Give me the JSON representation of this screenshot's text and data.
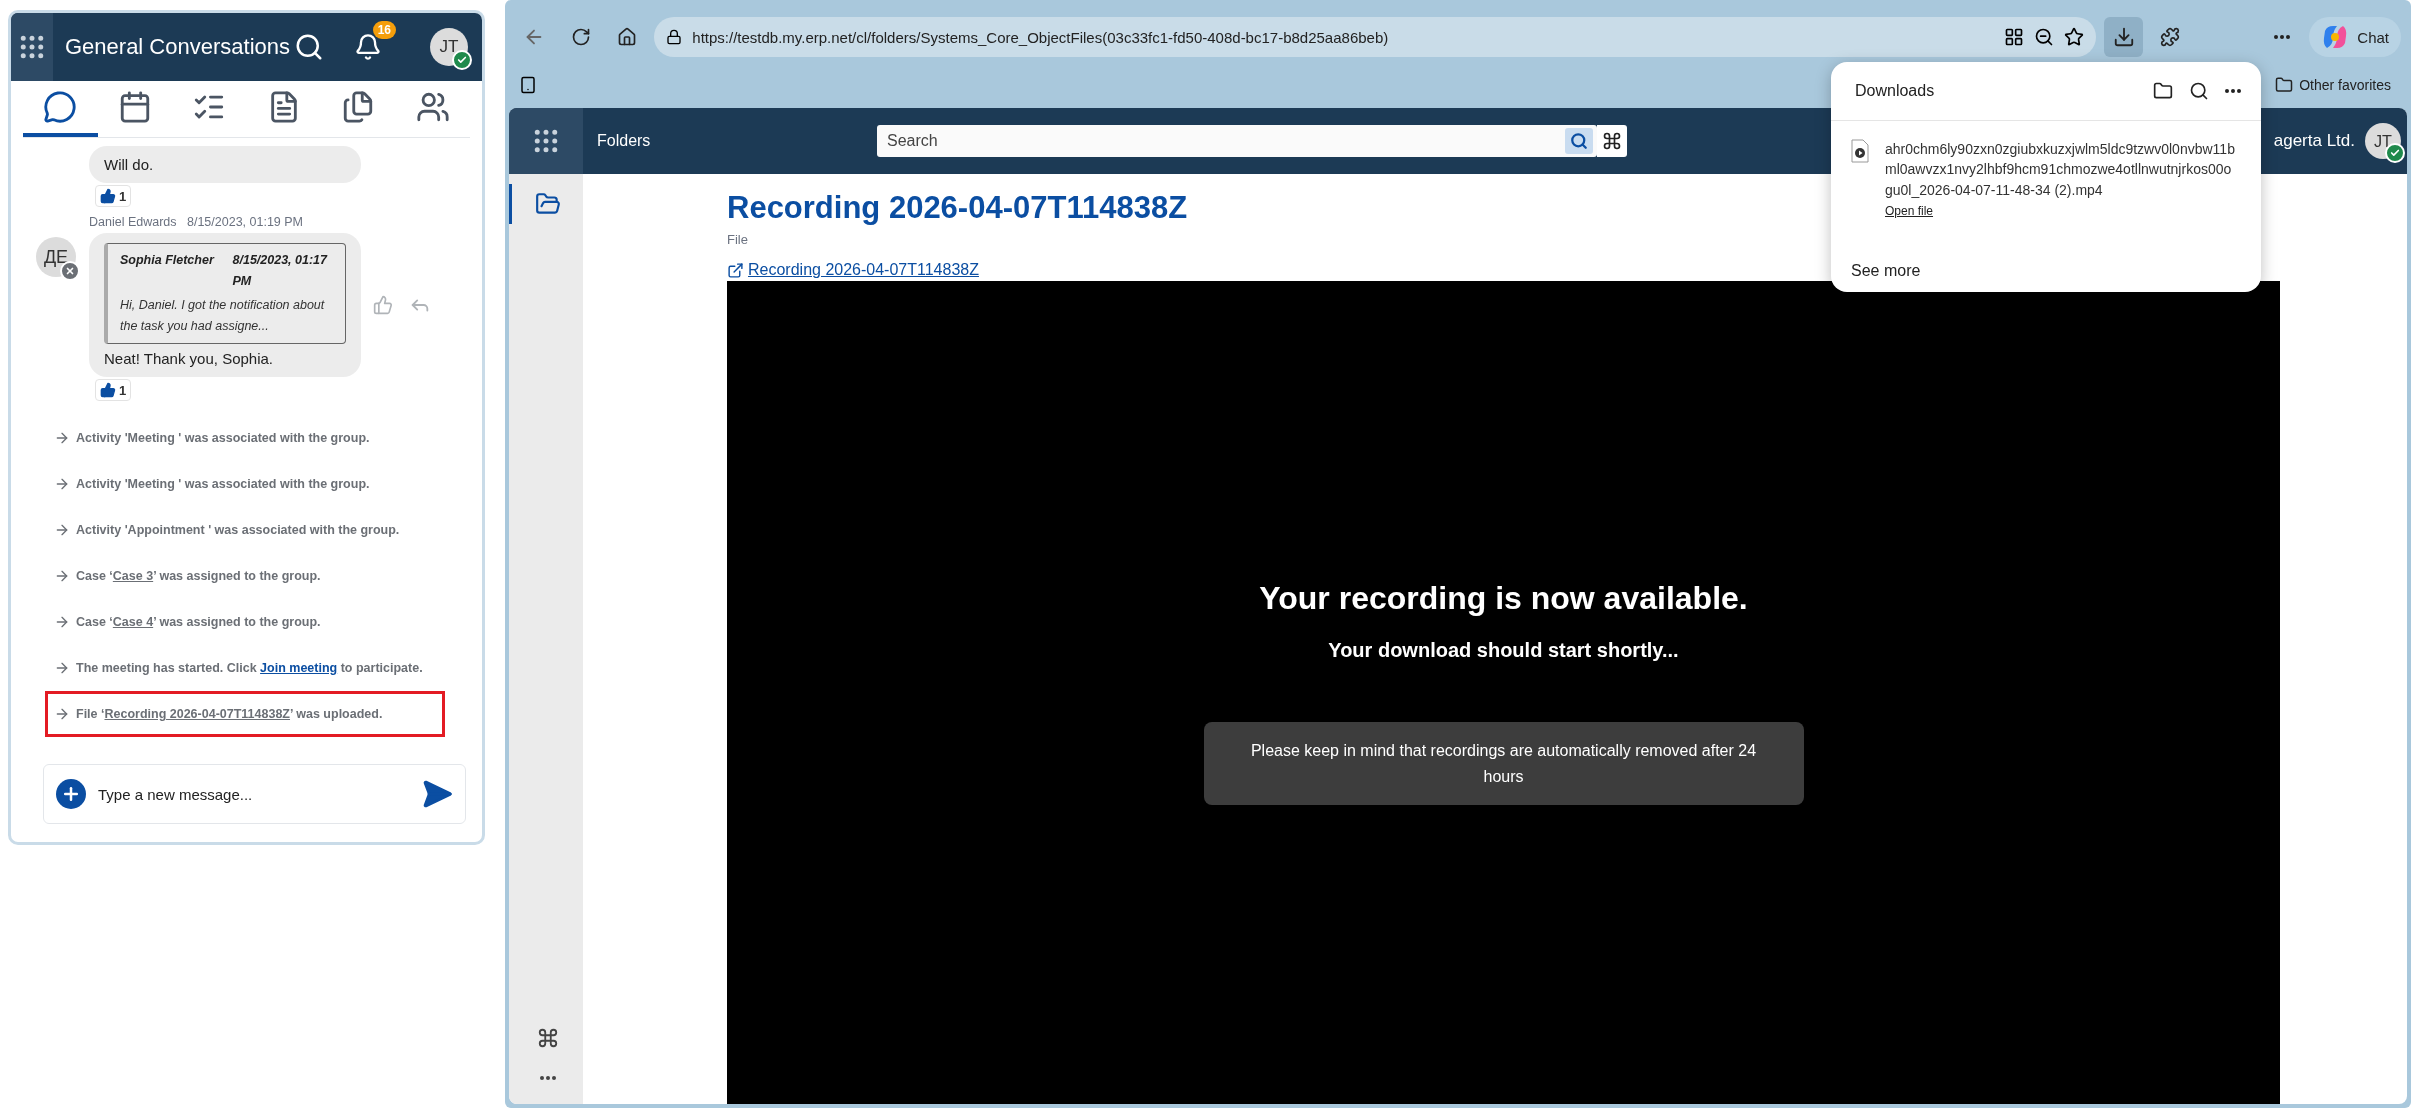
{
  "chat_panel": {
    "title": "General Conversations",
    "notification_count": "16",
    "user": {
      "initials": "JT",
      "online": true
    },
    "tabs": [
      {
        "kind": "chat",
        "selected": true
      },
      {
        "kind": "calendar",
        "selected": false
      },
      {
        "kind": "tasks",
        "selected": false
      },
      {
        "kind": "document",
        "selected": false
      },
      {
        "kind": "files",
        "selected": false
      },
      {
        "kind": "members",
        "selected": false
      }
    ],
    "messages": [
      {
        "text": "Will do.",
        "reactions": "1"
      },
      {
        "author": "Daniel Edwards",
        "time": "8/15/2023, 01:19 PM",
        "avatar": {
          "initials": "ДЕ",
          "online": false
        },
        "quote": {
          "author": "Sophia Fletcher",
          "time": "8/15/2023, 01:17 PM",
          "text": "Hi, Daniel. I got the notification about the task you had assigne..."
        },
        "text": "Neat! Thank you, Sophia.",
        "reactions": "1"
      }
    ],
    "events": [
      {
        "highlighted": false,
        "parts": [
          {
            "text": "Activity 'Meeting ' was associated with the group."
          }
        ]
      },
      {
        "highlighted": false,
        "parts": [
          {
            "text": "Activity 'Meeting ' was associated with the group."
          }
        ]
      },
      {
        "highlighted": false,
        "parts": [
          {
            "text": "Activity 'Appointment ' was associated with the group."
          }
        ]
      },
      {
        "highlighted": false,
        "parts": [
          {
            "text": "Case ‘"
          },
          {
            "text": "Case 3",
            "kind": "link"
          },
          {
            "text": "’ was assigned to the group."
          }
        ]
      },
      {
        "highlighted": false,
        "parts": [
          {
            "text": "Case ‘"
          },
          {
            "text": "Case 4",
            "kind": "link"
          },
          {
            "text": "’ was assigned to the group."
          }
        ]
      },
      {
        "highlighted": false,
        "parts": [
          {
            "text": "The meeting has started. Click "
          },
          {
            "text": "Join meeting",
            "kind": "action_link"
          },
          {
            "text": " to participate."
          }
        ]
      },
      {
        "highlighted": true,
        "parts": [
          {
            "text": "File ‘"
          },
          {
            "text": "Recording 2026-04-07T114838Z",
            "kind": "link"
          },
          {
            "text": "’ was uploaded."
          }
        ]
      }
    ],
    "composer": {
      "placeholder": "Type a new message..."
    }
  },
  "browser": {
    "url": "https://testdb.my.erp.net/cl/folders/Systems_Core_ObjectFiles(03c33fc1-fd50-408d-bc17-b8d25aa86beb)",
    "chat_label": "Chat",
    "favorites": "Other favorites",
    "app": {
      "section": "Folders",
      "search_placeholder": "Search",
      "company": "agerta Ltd.",
      "user": {
        "initials": "JT",
        "online": true
      }
    },
    "page": {
      "title": "Recording 2026-04-07T114838Z",
      "subtitle": "File",
      "link": "Recording 2026-04-07T114838Z",
      "video": {
        "heading": "Your recording is now available.",
        "subheading": "Your download should start shortly...",
        "notice": "Please keep in mind that recordings are automatically removed after 24 hours"
      }
    },
    "downloads": {
      "title": "Downloads",
      "file_name": "ahr0chm6ly90zxn0zgiubxkuzxjwlm5ldc9tzwv0l0nvbw11bml0awvzx1nvy2lhbf9hcm91chmozwe4otllnwutnjrkos00ogu0l_2026-04-07-11-48-34 (2).mp4",
      "open_label": "Open file",
      "see_more": "See more"
    }
  }
}
